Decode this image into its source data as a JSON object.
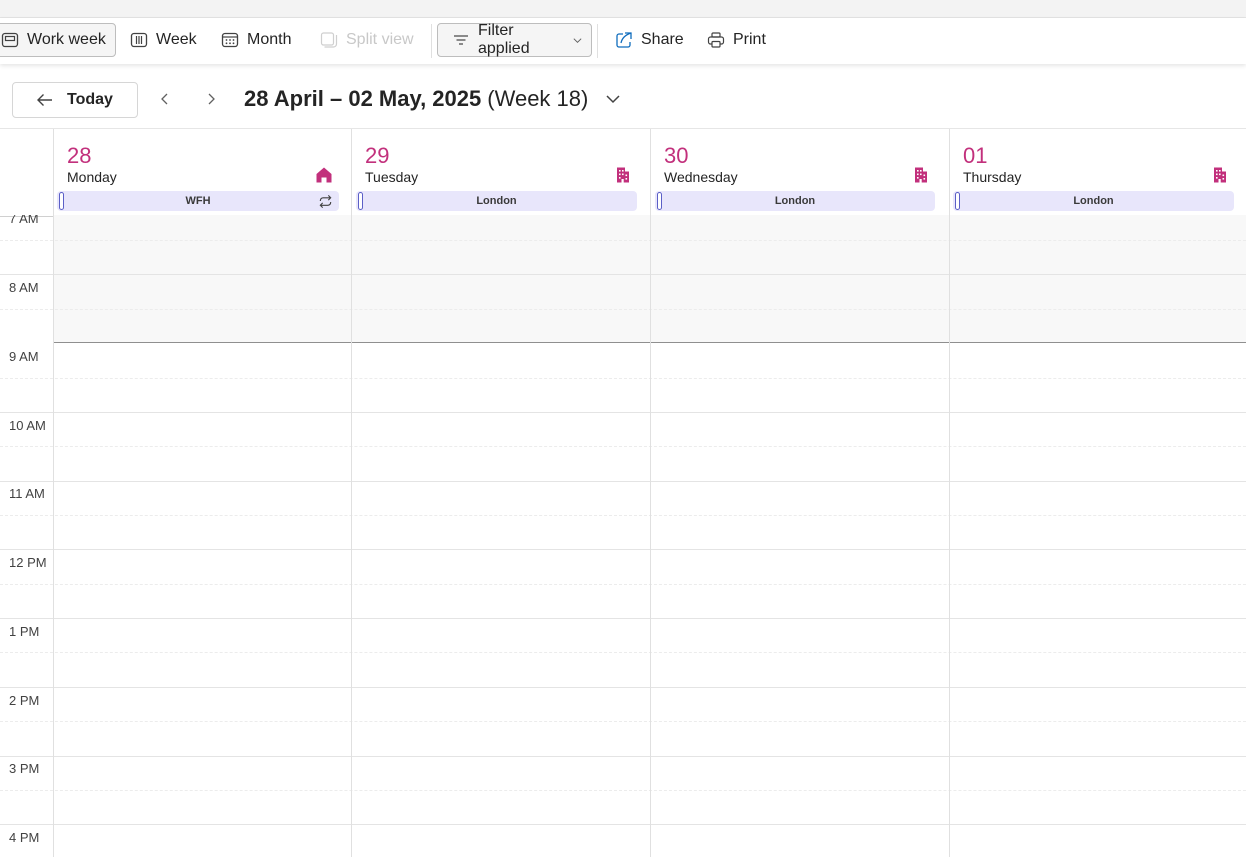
{
  "toolbar": {
    "work_week": "Work week",
    "week": "Week",
    "month": "Month",
    "split_view": "Split view",
    "filter": "Filter applied",
    "share": "Share",
    "print": "Print"
  },
  "nav": {
    "today": "Today",
    "range_bold": "28 April – 02 May, 2025",
    "range_week": "(Week 18)"
  },
  "days": [
    {
      "num": "28",
      "name": "Monday",
      "location_icon": "home-icon",
      "work_location": "WFH",
      "recurring": true
    },
    {
      "num": "29",
      "name": "Tuesday",
      "location_icon": "office-building-icon",
      "work_location": "London",
      "recurring": false
    },
    {
      "num": "30",
      "name": "Wednesday",
      "location_icon": "office-building-icon",
      "work_location": "London",
      "recurring": false
    },
    {
      "num": "01",
      "name": "Thursday",
      "location_icon": "office-building-icon",
      "work_location": "London",
      "recurring": false
    }
  ],
  "times": [
    "7 AM",
    "8 AM",
    "9 AM",
    "10 AM",
    "11 AM",
    "12 PM",
    "1 PM",
    "2 PM",
    "3 PM",
    "4 PM"
  ],
  "colors": {
    "accent_pink": "#c2307c",
    "location_pill": "#e8e6fb",
    "pill_mark": "#5b5fc7",
    "share_icon": "#0f6cbd"
  }
}
